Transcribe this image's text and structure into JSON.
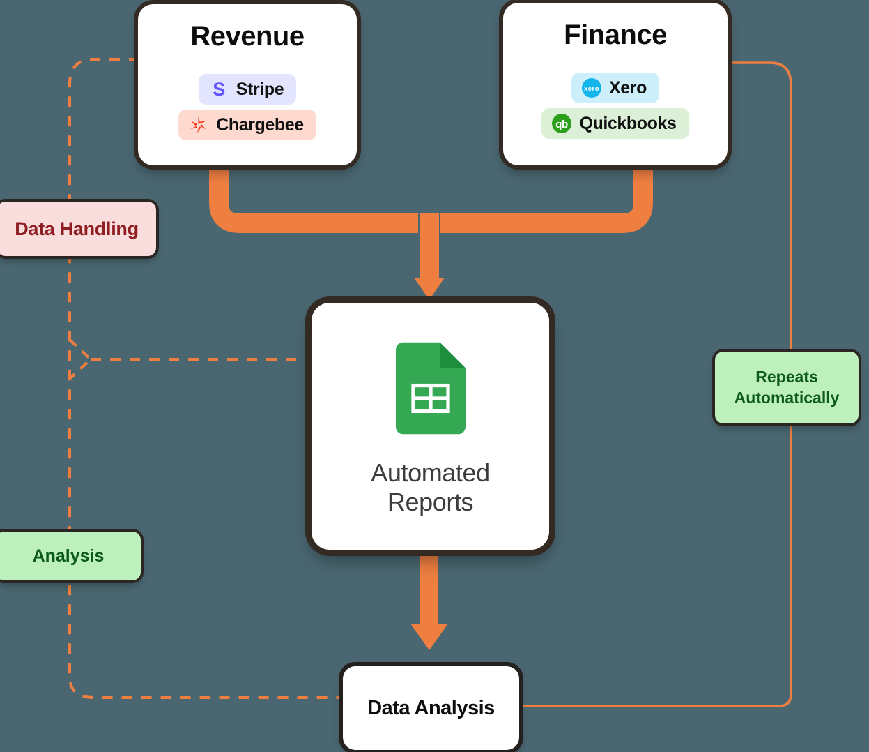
{
  "canvas": {
    "background": "#4a6771",
    "accent_orange": "#ee7f41",
    "shadow_dark": "#332a24"
  },
  "cards": {
    "revenue": {
      "title": "Revenue",
      "integrations": [
        {
          "label": "Stripe",
          "icon": "stripe-icon",
          "bg": "#e3e4fd",
          "brand": "#6257fb"
        },
        {
          "label": "Chargebee",
          "icon": "chargebee-icon",
          "bg": "#fdd9cf",
          "brand": "#ff3d1f"
        }
      ]
    },
    "finance": {
      "title": "Finance",
      "integrations": [
        {
          "label": "Xero",
          "icon": "xero-icon",
          "bg": "#cdeefb",
          "brand": "#13b5ea"
        },
        {
          "label": "Quickbooks",
          "icon": "quickbooks-icon",
          "bg": "#dcf0d8",
          "brand": "#2ca01c"
        }
      ]
    },
    "reports": {
      "icon": "google-sheets-icon",
      "label": "Automated\nReports",
      "label_line1": "Automated",
      "label_line2": "Reports",
      "brand": "#34a853"
    },
    "data_analysis": {
      "title": "Data Analysis"
    }
  },
  "annotations": {
    "data_handling": {
      "label": "Data Handling",
      "bg": "#fadddd",
      "text_color": "#8f1e22"
    },
    "analysis": {
      "label": "Analysis",
      "bg": "#bdf0bc",
      "text_color": "#0d5b1c"
    },
    "repeats": {
      "label_line1": "Repeats",
      "label_line2": "Automatically",
      "bg": "#bdf0bc",
      "text_color": "#0d5b1c"
    }
  },
  "connectors": [
    {
      "name": "revenue-to-reports",
      "style": "thick-solid-arrow",
      "color": "#ee7f41",
      "from": "revenue",
      "to": "reports"
    },
    {
      "name": "finance-to-reports",
      "style": "thick-solid-arrow",
      "color": "#ee7f41",
      "from": "finance",
      "to": "reports"
    },
    {
      "name": "reports-to-data-analysis",
      "style": "thick-solid-arrow",
      "color": "#ee7f41",
      "from": "reports",
      "to": "data_analysis"
    },
    {
      "name": "revenue-data-handling-branch",
      "style": "thin-dashed",
      "color": "#ee7f41",
      "from": "revenue",
      "to": "reports"
    },
    {
      "name": "analysis-to-data-analysis",
      "style": "thin-dashed",
      "color": "#ee7f41",
      "from": "analysis",
      "to": "data_analysis"
    },
    {
      "name": "finance-repeats-loop",
      "style": "thin-solid",
      "color": "#ee7f41",
      "from": "finance",
      "to": "data_analysis"
    }
  ]
}
